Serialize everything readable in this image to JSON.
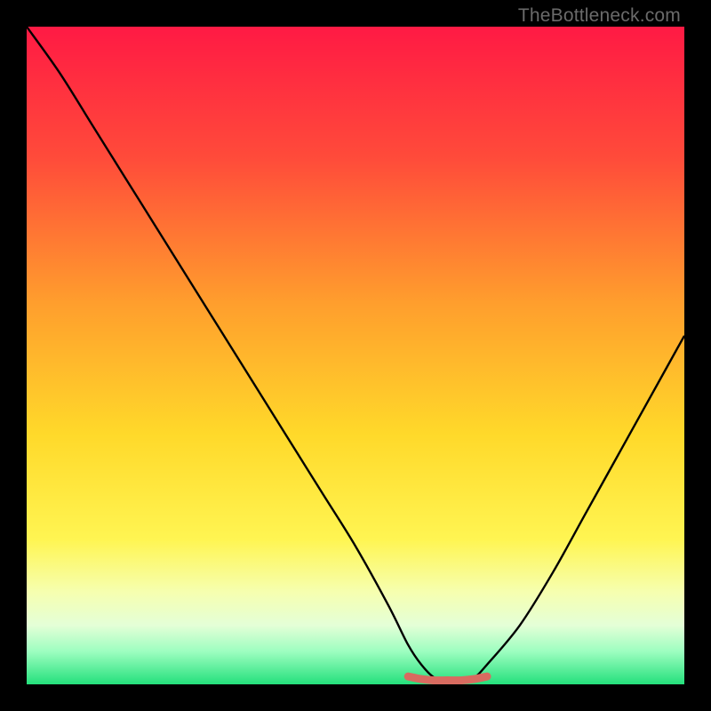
{
  "watermark": "TheBottleneck.com",
  "chart_data": {
    "type": "line",
    "title": "",
    "xlabel": "",
    "ylabel": "",
    "xlim": [
      0,
      100
    ],
    "ylim": [
      0,
      100
    ],
    "grid": false,
    "gradient_stops": [
      {
        "offset": 0,
        "color": "#ff1a44"
      },
      {
        "offset": 20,
        "color": "#ff4b3a"
      },
      {
        "offset": 42,
        "color": "#ff9e2d"
      },
      {
        "offset": 62,
        "color": "#ffd92a"
      },
      {
        "offset": 78,
        "color": "#fff552"
      },
      {
        "offset": 86,
        "color": "#f6ffb0"
      },
      {
        "offset": 91,
        "color": "#e4ffd7"
      },
      {
        "offset": 95,
        "color": "#9dfec0"
      },
      {
        "offset": 100,
        "color": "#24e07c"
      }
    ],
    "series": [
      {
        "name": "bottleneck-curve",
        "color": "#000000",
        "x": [
          0,
          5,
          10,
          15,
          20,
          25,
          30,
          35,
          40,
          45,
          50,
          55,
          58,
          60,
          62,
          64,
          66,
          68,
          70,
          75,
          80,
          85,
          90,
          95,
          100
        ],
        "values": [
          100,
          93,
          85,
          77,
          69,
          61,
          53,
          45,
          37,
          29,
          21,
          12,
          6,
          3,
          1,
          0.5,
          0.5,
          1,
          3,
          9,
          17,
          26,
          35,
          44,
          53
        ]
      },
      {
        "name": "optimal-band",
        "color": "#d86b60",
        "x": [
          58,
          60,
          62,
          64,
          66,
          68,
          70
        ],
        "values": [
          1.2,
          0.8,
          0.6,
          0.6,
          0.6,
          0.8,
          1.2
        ]
      }
    ]
  }
}
